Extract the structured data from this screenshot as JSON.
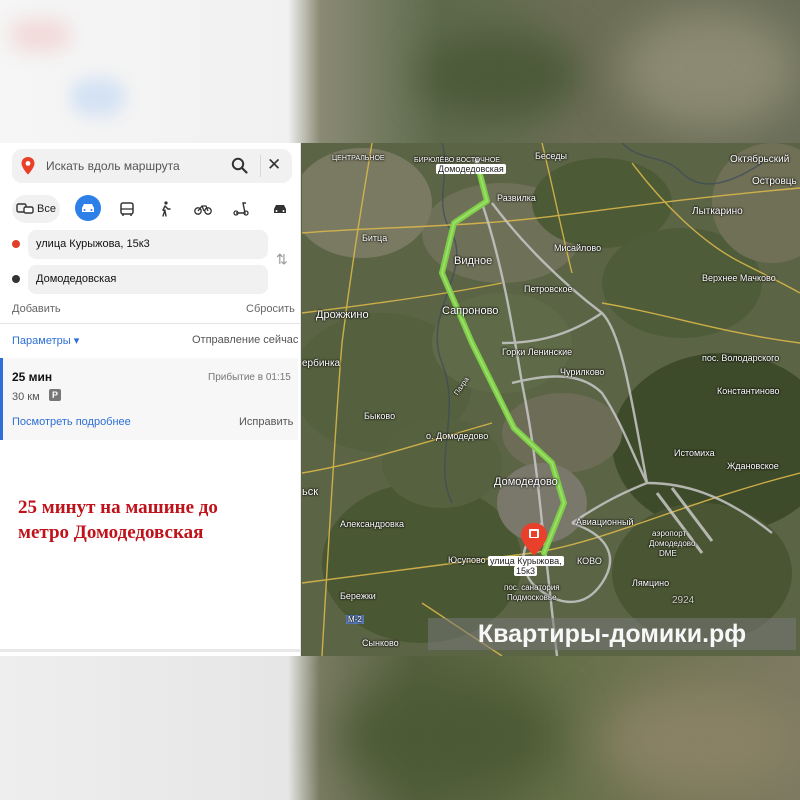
{
  "search": {
    "placeholder": "Искать вдоль маршрута"
  },
  "modes": {
    "all_label": "Все",
    "selected": "car"
  },
  "route": {
    "from": "улица Курыжова, 15к3",
    "to": "Домодедовская"
  },
  "actions": {
    "add": "Добавить",
    "reset": "Сбросить"
  },
  "params": {
    "label": "Параметры ▾",
    "departure": "Отправление сейчас"
  },
  "result": {
    "time": "25 мин",
    "arrival": "Прибытие в 01:15",
    "distance": "30 км",
    "details": "Посмотреть подробнее",
    "fix": "Исправить",
    "toll_icon": "P"
  },
  "caption": {
    "line1": "25 минут на машине до",
    "line2": "метро Домодедовская"
  },
  "map": {
    "labels": {
      "oktyabrsky": "Октябрьский",
      "ostrovtsy": "Островць",
      "lytkarino": "Лыткарино",
      "beseda": "Беседы",
      "razvilka": "Развилка",
      "misailovo": "Мисайлово",
      "vidnoe": "Видное",
      "bitsa": "Битца",
      "birulevo": "БИРЮЛЁВО\nВОСТОЧНОЕ",
      "tsaritsyno": "ЦЕНТРАЛЬНОЕ",
      "verkhnee": "Верхнее Мачково",
      "petrovskoe": "Петровское",
      "drozhzhino": "Дрожжино",
      "sapronovo": "Сапроново",
      "gorki": "Горки Ленинские",
      "churilkovo": "Чурилково",
      "volodarsky": "пос. Володарского",
      "konstantinovo": "Константиново",
      "berbinka": "ербинка",
      "bykovo": "Быково",
      "odomodedovo": "о. Домодедово",
      "istomikha": "Истомиха",
      "zhdanovskoe": "Ждановское",
      "domodedovo": "Домодедово",
      "aviatsionny": "Авиационный",
      "airport1": "аэропорт",
      "airport2": "Домодедово",
      "airport3": "DME",
      "aleksandrovka": "Александровка",
      "kovo": "КОВО",
      "yusupovo": "Юсупово",
      "lyamtsino": "Лямцино",
      "sanatorium1": "пос. санатория",
      "sanatorium2": "Подмосковье",
      "berezhki": "Бережки",
      "synkovo": "Сынково",
      "ramenskoe": "ьск",
      "pakhra": "Пахра",
      "m2": "М-2",
      "code": "2924",
      "top_station": "Домодедовская",
      "dest1": "улица Курыжова,",
      "dest2": "15к3"
    }
  },
  "watermark": "Квартиры-домики.рф",
  "colors": {
    "route": "#7ccf45",
    "accent": "#2d80e8",
    "caption": "#c0121a",
    "start_dot": "#e0402a",
    "end_dot": "#333333"
  }
}
